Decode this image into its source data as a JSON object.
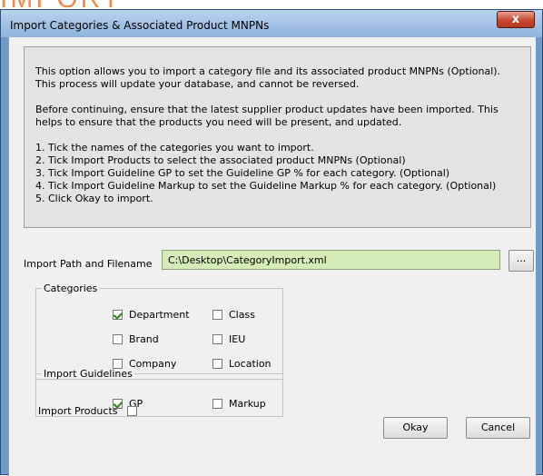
{
  "background": {
    "heading": "IMPORT"
  },
  "dialog": {
    "title": "Import Categories & Associated Product MNPNs",
    "close_label": "x",
    "info": {
      "para1": "This option allows you to import a category file and its associated product MNPNs (Optional). This process will update your database, and cannot be reversed.",
      "para2": "Before continuing, ensure that the latest supplier product updates have been imported. This helps to ensure that the products you need will be present, and updated.",
      "steps": [
        "1. Tick the names of the categories you want to import.",
        "2. Tick Import Products to select the associated product MNPNs (Optional)",
        "3. Tick Import Guideline GP to set the Guideline GP % for each category. (Optional)",
        "4. Tick Import Guideline Markup to set the Guideline Markup % for each category. (Optional)",
        "5. Click Okay to import."
      ]
    },
    "path": {
      "label": "Import Path and Filename",
      "value": "C:\\Desktop\\CategoryImport.xml",
      "browse_label": "..."
    },
    "categories": {
      "title": "Categories",
      "items": [
        {
          "label": "Department",
          "checked": true
        },
        {
          "label": "Class",
          "checked": false
        },
        {
          "label": "Brand",
          "checked": false
        },
        {
          "label": "IEU",
          "checked": false
        },
        {
          "label": "Company",
          "checked": false
        },
        {
          "label": "Location",
          "checked": false
        }
      ]
    },
    "guidelines": {
      "title": "Import Guidelines",
      "items": [
        {
          "label": "GP",
          "checked": true
        },
        {
          "label": "Markup",
          "checked": false
        }
      ]
    },
    "import_products": {
      "label": "Import Products",
      "checked": false
    },
    "okay_label": "Okay",
    "cancel_label": "Cancel"
  }
}
